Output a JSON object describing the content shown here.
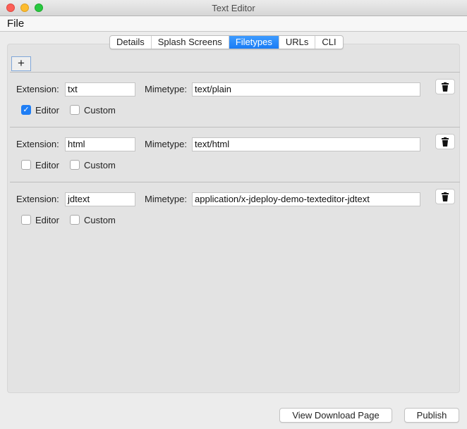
{
  "window": {
    "title": "Text Editor"
  },
  "menu": {
    "file": "File"
  },
  "tabs": [
    {
      "label": "Details",
      "active": false
    },
    {
      "label": "Splash Screens",
      "active": false
    },
    {
      "label": "Filetypes",
      "active": true
    },
    {
      "label": "URLs",
      "active": false
    },
    {
      "label": "CLI",
      "active": false
    }
  ],
  "add_label": "+",
  "labels": {
    "extension": "Extension:",
    "mimetype": "Mimetype:",
    "editor": "Editor",
    "custom": "Custom"
  },
  "filetypes": [
    {
      "extension": "txt",
      "mimetype": "text/plain",
      "editor": true,
      "custom": false
    },
    {
      "extension": "html",
      "mimetype": "text/html",
      "editor": false,
      "custom": false
    },
    {
      "extension": "jdtext",
      "mimetype": "application/x-jdeploy-demo-texteditor-jdtext",
      "editor": false,
      "custom": false
    }
  ],
  "footer": {
    "view_download": "View Download Page",
    "publish": "Publish"
  },
  "colors": {
    "accent": "#1f7ef5"
  }
}
